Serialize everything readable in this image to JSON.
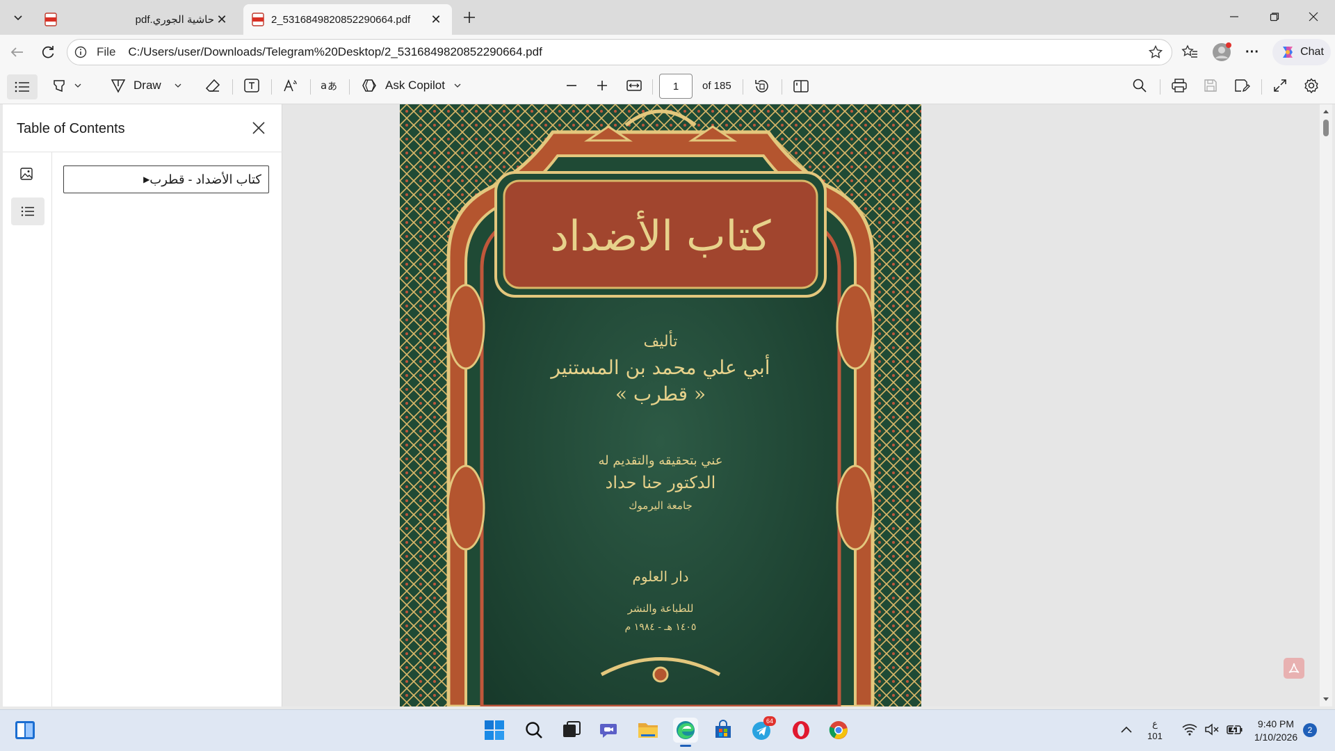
{
  "browser": {
    "tabs": [
      {
        "label": "حاشية الجوري.pdf",
        "active": false
      },
      {
        "label": "2_5316849820852290664.pdf",
        "active": true
      }
    ],
    "address": {
      "scheme_label": "File",
      "url": "C:/Users/user/Downloads/Telegram%20Desktop/2_5316849820852290664.pdf"
    },
    "chat_label": "Chat"
  },
  "pdf_toolbar": {
    "draw_label": "Draw",
    "copilot_label": "Ask Copilot",
    "page_current": "1",
    "page_total_label": "of 185"
  },
  "toc": {
    "title": "Table of Contents",
    "items": [
      {
        "label": "كتاب الأضداد - قطرب"
      }
    ]
  },
  "cover": {
    "title": "كتاب الأضداد",
    "author_prefix": "تأليف",
    "author": "أبي علي محمد بن المستنير",
    "author_nick": "« قطرب »",
    "editor_prefix": "عني بتحقيقه والتقديم له",
    "editor": "الدكتور حنا حداد",
    "editor_affiliation": "جامعة اليرموك",
    "publisher": "دار العلوم",
    "publisher_sub": "للطباعة والنشر",
    "date": "١٤٠٥ هـ - ١٩٨٤ م"
  },
  "taskbar": {
    "telegram_badge": "64",
    "kbd_lang": "ع",
    "kbd_sub": "101",
    "time": "9:40 PM",
    "date": "1/10/2026",
    "notifications": "2"
  },
  "colors": {
    "accent": "#0067c0",
    "cover_green": "#1f4a35",
    "cover_red": "#a1452e",
    "gold": "#d9b768"
  }
}
